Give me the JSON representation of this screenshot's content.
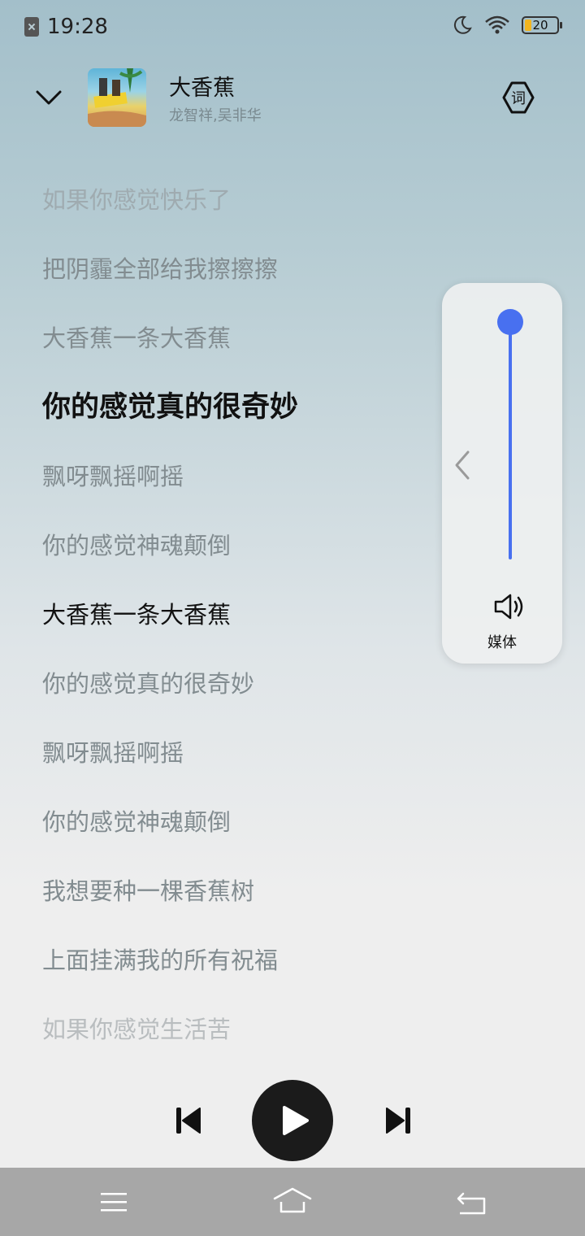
{
  "status_bar": {
    "time": "19:28",
    "battery_level": "20",
    "battery_fraction": 0.2,
    "icons": [
      "sim-off-icon",
      "moon-icon",
      "wifi-icon",
      "battery-icon"
    ],
    "battery_color": "#f2b51f"
  },
  "header": {
    "title": "大香蕉",
    "artist": "龙智祥,吴非华",
    "lyrics_button_label": "词"
  },
  "lyrics": [
    "如果你感觉快乐了",
    "把阴霾全部给我擦擦擦",
    "大香蕉一条大香蕉",
    "你的感觉真的很奇妙",
    "飘呀飘摇啊摇",
    "你的感觉神魂颠倒",
    "大香蕉一条大香蕉",
    "你的感觉真的很奇妙",
    "飘呀飘摇啊摇",
    "你的感觉神魂颠倒",
    "我想要种一棵香蕉树",
    "上面挂满我的所有祝福",
    "如果你感觉生活苦"
  ],
  "current_lyric_index": 3,
  "volume": {
    "level": 1.0,
    "label": "媒体",
    "accent_color": "#4870f0"
  },
  "controls": {
    "state": "paused"
  },
  "nav": {
    "icons": [
      "menu-icon",
      "home-icon",
      "back-icon"
    ]
  }
}
